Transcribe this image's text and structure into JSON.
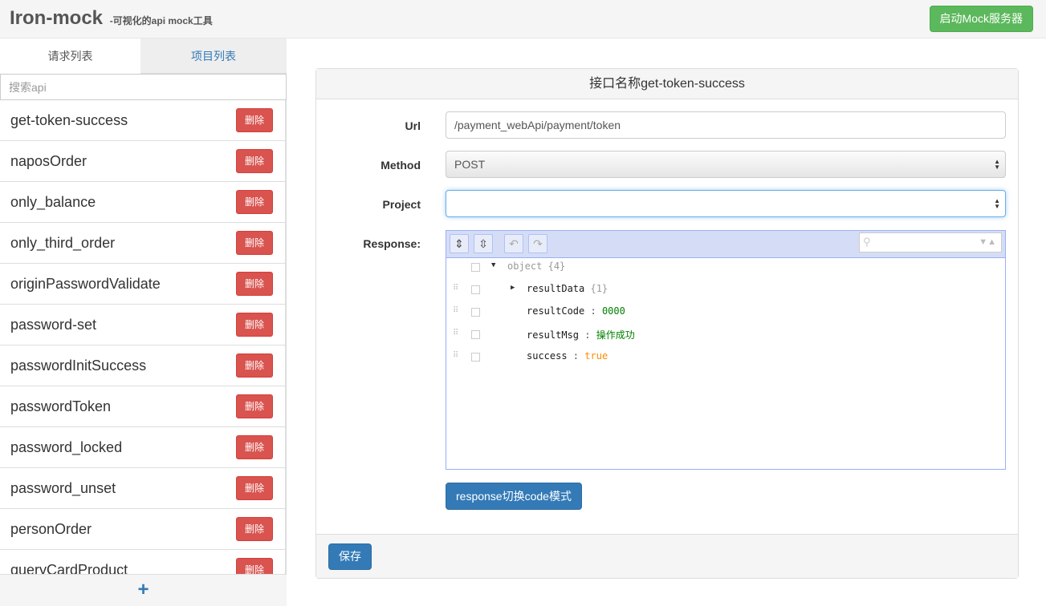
{
  "header": {
    "brand": "Iron-mock",
    "brand_sub": "-可视化的api mock工具",
    "start_button": "启动Mock服务器"
  },
  "sidebar": {
    "tabs": [
      {
        "label": "请求列表",
        "active": true
      },
      {
        "label": "项目列表",
        "active": false
      }
    ],
    "search_placeholder": "搜索api",
    "delete_label": "删除",
    "items": [
      "get-token-success",
      "naposOrder",
      "only_balance",
      "only_third_order",
      "originPasswordValidate",
      "password-set",
      "passwordInitSuccess",
      "passwordToken",
      "password_locked",
      "password_unset",
      "personOrder",
      "queryCardProduct"
    ],
    "add_label": "+"
  },
  "panel": {
    "heading": "接口名称get-token-success",
    "url_label": "Url",
    "url_value": "/payment_webApi/payment/token",
    "method_label": "Method",
    "method_value": "POST",
    "project_label": "Project",
    "project_value": "",
    "response_label": "Response:",
    "mode_button": "response切换code模式",
    "save_button": "保存"
  },
  "json_editor": {
    "root": {
      "key": "object",
      "meta": "{4}"
    },
    "rows": [
      {
        "key": "resultData",
        "meta": "{1}",
        "collapsed": true
      },
      {
        "key": "resultCode",
        "value": "0000",
        "type": "num"
      },
      {
        "key": "resultMsg",
        "value": "操作成功",
        "type": "str"
      },
      {
        "key": "success",
        "value": "true",
        "type": "bool"
      }
    ]
  }
}
